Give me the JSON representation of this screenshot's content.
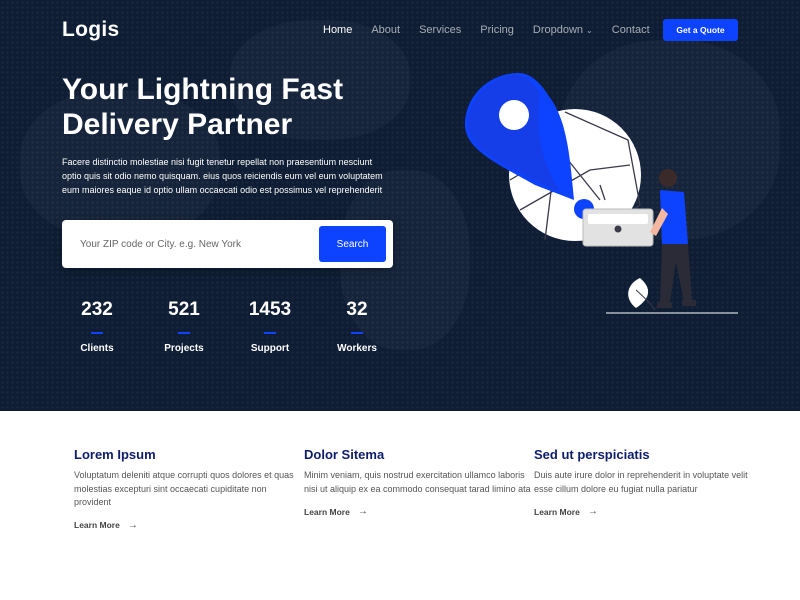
{
  "brand": {
    "logo": "Logis"
  },
  "nav": {
    "items": [
      {
        "label": "Home",
        "active": true
      },
      {
        "label": "About"
      },
      {
        "label": "Services"
      },
      {
        "label": "Pricing"
      },
      {
        "label": "Dropdown",
        "has_dropdown": true
      },
      {
        "label": "Contact"
      }
    ],
    "cta": "Get a Quote"
  },
  "hero": {
    "title_line1": "Your Lightning Fast",
    "title_line2": "Delivery Partner",
    "description": "Facere distinctio molestiae nisi fugit tenetur repellat non praesentium nesciunt optio quis sit odio nemo quisquam. eius quos reiciendis eum vel eum voluptatem eum maiores eaque id optio ullam occaecati odio est possimus vel reprehenderit",
    "search": {
      "placeholder": "Your ZIP code or City. e.g. New York",
      "button": "Search"
    },
    "stats": [
      {
        "value": "232",
        "label": "Clients"
      },
      {
        "value": "521",
        "label": "Projects"
      },
      {
        "value": "1453",
        "label": "Support"
      },
      {
        "value": "32",
        "label": "Workers"
      }
    ]
  },
  "features": [
    {
      "title": "Lorem Ipsum",
      "text": "Voluptatum deleniti atque corrupti quos dolores et quas molestias excepturi sint occaecati cupiditate non provident",
      "link": "Learn More"
    },
    {
      "title": "Dolor Sitema",
      "text": "Minim veniam, quis nostrud exercitation ullamco laboris nisi ut aliquip ex ea commodo consequat tarad limino ata",
      "link": "Learn More"
    },
    {
      "title": "Sed ut perspiciatis",
      "text": "Duis aute irure dolor in reprehenderit in voluptate velit esse cillum dolore eu fugiat nulla pariatur",
      "link": "Learn More"
    }
  ],
  "colors": {
    "hero_bg": "#0e1d34",
    "accent": "#0d42ff",
    "feature_title": "#0e1d6b"
  },
  "icons": {
    "dropdown": "chevron-down-icon",
    "learn_more": "arrow-right-icon",
    "illustration": "location-pin-delivery-illustration"
  }
}
